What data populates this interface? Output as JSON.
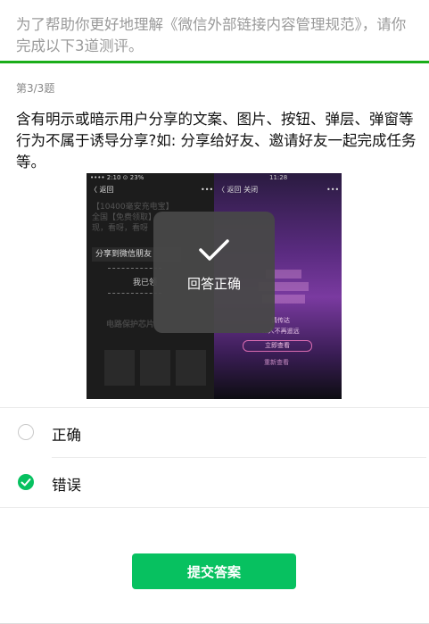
{
  "intro": {
    "text": "为了帮助你更好地理解《微信外部链接内容管理规范》，请你完成以下3道测评。"
  },
  "progress": {
    "label": "第3/3题"
  },
  "question": {
    "text": "含有明示或暗示用户分享的文案、图片、按钮、弹层、弹窗等行为不属于诱导分享?如: 分享给好友、邀请好友一起完成任务等。"
  },
  "image": {
    "left_status": "•••• 2:10  ⊙ 23%",
    "left_nav_back": "〈 返回",
    "left_nav_more": "•••",
    "left_text_1": "【10400毫安充电宝】",
    "left_text_2": "全国【免费领取】",
    "left_text_3": "现，看呀，看呀",
    "left_share_button": "分享到微信朋友",
    "left_text_4": "我已领",
    "left_text_5": "电路保护芯片",
    "right_status": "11:28",
    "right_nav_back": "〈 返回  关闭",
    "right_nav_more": "•••",
    "right_text_1": "请传达",
    "right_text_2": "...人不再遥远",
    "right_pill": "立即查看",
    "right_text_3": "重新查看"
  },
  "toast": {
    "message": "回答正确"
  },
  "options": [
    {
      "label": "正确",
      "selected": false
    },
    {
      "label": "错误",
      "selected": true
    }
  ],
  "submit": {
    "label": "提交答案"
  },
  "colors": {
    "accent": "#07c160",
    "toast_bg": "#484848"
  }
}
